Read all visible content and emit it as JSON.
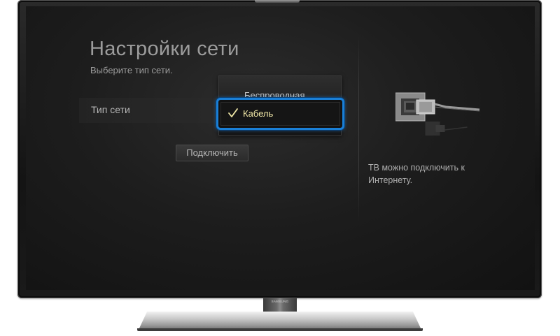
{
  "tv": {
    "brand": "SAMSUNG"
  },
  "screen": {
    "title": "Настройки сети",
    "subtitle": "Выберите тип сети.",
    "setting": {
      "label": "Тип сети"
    },
    "dropdown": {
      "options": [
        "Беспроводная",
        "Кабель"
      ],
      "selected": "Кабель"
    },
    "connect_button": "Подключить",
    "info_text": "ТВ можно подключить к Интернету."
  },
  "colors": {
    "focus_border": "#1a7fd6",
    "selected_text": "#f2e9a8",
    "screen_background": "#1d1d1d"
  },
  "icons": {
    "check": "check-icon",
    "cable": "ethernet-cable-icon"
  }
}
